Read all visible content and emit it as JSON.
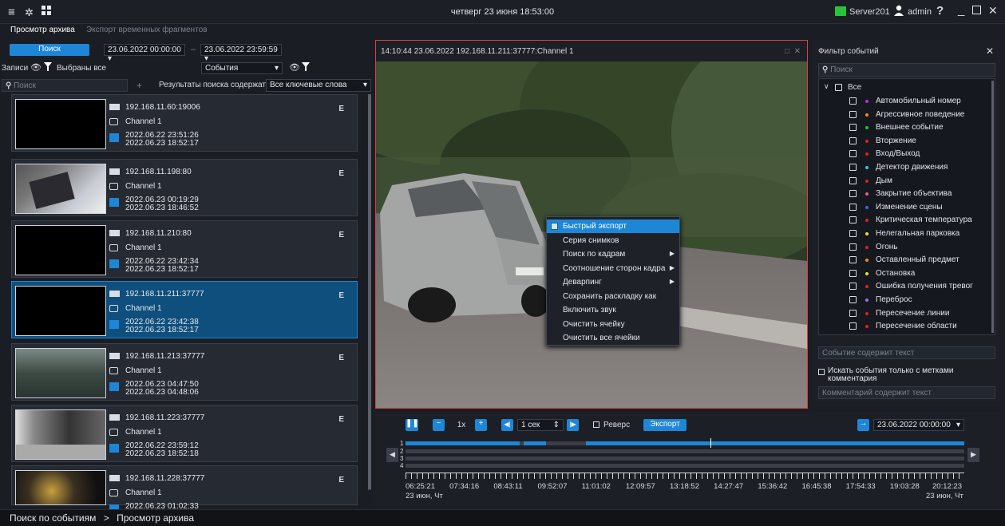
{
  "topbar": {
    "menu_icon": "hamburger-icon",
    "settings_icon": "gear-icon",
    "layout_icon": "grid-icon",
    "datetime": "четверг 23 июня 18:53:00",
    "server": "Server201",
    "user": "admin",
    "help": "?"
  },
  "tabs": [
    {
      "label": "Просмотр архива",
      "active": true
    },
    {
      "label": "Экспорт временных фрагментов",
      "active": false
    }
  ],
  "search_panel": {
    "search_button": "Поиск",
    "date_from": "23.06.2022 00:00:00",
    "date_to": "23.06.2022 23:59:59",
    "dash": "–",
    "records_label": "Записи",
    "selected_all": "Выбраны все",
    "events_select": "События",
    "search_placeholder": "Поиск",
    "add": "+",
    "results_label": "Результаты поиска содержат",
    "keywords_select": "Все ключевые слова"
  },
  "records": [
    {
      "ip": "192.168.11.60:19006",
      "channel": "Channel 1",
      "start": "2022.06.22 23:51:26",
      "end": "2022.06.23 18:52:17",
      "badge": "E",
      "selected": false,
      "thumb": "black"
    },
    {
      "ip": "192.168.11.198:80",
      "channel": "Channel 1",
      "start": "2022.06.23 00:19:29",
      "end": "2022.06.23 18:46:52",
      "badge": "E",
      "selected": false,
      "thumb": "camera"
    },
    {
      "ip": "192.168.11.210:80",
      "channel": "Channel 1",
      "start": "2022.06.22 23:42:34",
      "end": "2022.06.23 18:52:17",
      "badge": "E",
      "selected": false,
      "thumb": "black"
    },
    {
      "ip": "192.168.11.211:37777",
      "channel": "Channel 1",
      "start": "2022.06.22 23:42:38",
      "end": "2022.06.23 18:52:17",
      "badge": "E",
      "selected": true,
      "thumb": "black"
    },
    {
      "ip": "192.168.11.213:37777",
      "channel": "Channel 1",
      "start": "2022.06.23 04:47:50",
      "end": "2022.06.23 04:48:06",
      "badge": "E",
      "selected": false,
      "thumb": "street"
    },
    {
      "ip": "192.168.11.223:37777",
      "channel": "Channel 1",
      "start": "2022.06.22 23:59:12",
      "end": "2022.06.23 18:52:18",
      "badge": "E",
      "selected": false,
      "thumb": "window"
    },
    {
      "ip": "192.168.11.228:37777",
      "channel": "Channel 1",
      "start": "2022.06.23 01:02:33",
      "end": "",
      "badge": "E",
      "selected": false,
      "thumb": "night"
    }
  ],
  "video": {
    "header": "14:10:44  23.06.2022  192.168.11.211:37777:Channel 1",
    "maximize": "□",
    "close": "✕"
  },
  "context_menu": [
    {
      "label": "Быстрый экспорт",
      "highlight": true,
      "submenu": false
    },
    {
      "label": "Серия снимков",
      "highlight": false,
      "submenu": false
    },
    {
      "label": "Поиск по кадрам",
      "highlight": false,
      "submenu": true
    },
    {
      "label": "Соотношение сторон кадра",
      "highlight": false,
      "submenu": true
    },
    {
      "label": "Деварпинг",
      "highlight": false,
      "submenu": true
    },
    {
      "label": "Сохранить раскладку как",
      "highlight": false,
      "submenu": false
    },
    {
      "label": "Включить звук",
      "highlight": false,
      "submenu": false
    },
    {
      "label": "Очистить ячейку",
      "highlight": false,
      "submenu": false
    },
    {
      "label": "Очистить все ячейки",
      "highlight": false,
      "submenu": false
    }
  ],
  "filter": {
    "title": "Фильтр событий",
    "close": "✕",
    "search_placeholder": "Поиск",
    "all": "Все",
    "items": [
      {
        "label": "Автомобильный номер",
        "color": "#c22ad8"
      },
      {
        "label": "Агрессивное поведение",
        "color": "#f08a1c"
      },
      {
        "label": "Внешнее событие",
        "color": "#22c23a"
      },
      {
        "label": "Вторжение",
        "color": "#e02020"
      },
      {
        "label": "Вход/Выход",
        "color": "#e02020"
      },
      {
        "label": "Детектор движения",
        "color": "#28c8e8"
      },
      {
        "label": "Дым",
        "color": "#e02020"
      },
      {
        "label": "Закрытие объектива",
        "color": "#ee5a8a"
      },
      {
        "label": "Изменение сцены",
        "color": "#2a6ee8"
      },
      {
        "label": "Критическая температура",
        "color": "#e02020"
      },
      {
        "label": "Нелегальная парковка",
        "color": "#f0e020"
      },
      {
        "label": "Огонь",
        "color": "#e02020"
      },
      {
        "label": "Оставленный предмет",
        "color": "#f08a1c"
      },
      {
        "label": "Остановка",
        "color": "#f0e020"
      },
      {
        "label": "Ошибка получения тревог",
        "color": "#e02020"
      },
      {
        "label": "Переброс",
        "color": "#9a70e8"
      },
      {
        "label": "Пересечение линии",
        "color": "#e02020"
      },
      {
        "label": "Пересечение области",
        "color": "#e02020"
      }
    ],
    "event_text_placeholder": "Событие содержит текст",
    "only_comments": "Искать события только с метками комментария",
    "comment_placeholder": "Комментарий содержит текст"
  },
  "player": {
    "speed": "1x",
    "step": "1 сек",
    "reverse": "Реверс",
    "export": "Экспорт",
    "date": "23.06.2022 00:00:00",
    "tracks": [
      "1",
      "2",
      "3",
      "4"
    ],
    "times": [
      "06:25:21",
      "07:34:16",
      "08:43:11",
      "09:52:07",
      "11:01:02",
      "12:09:57",
      "13:18:52",
      "14:27:47",
      "15:36:42",
      "16:45:38",
      "17:54:33",
      "19:03:28",
      "20:12:23"
    ],
    "date_left": "23 июн, Чт",
    "date_right": "23 июн, Чт"
  },
  "status": {
    "crumb1": "Поиск по событиям",
    "sep": ">",
    "crumb2": "Просмотр архива"
  }
}
